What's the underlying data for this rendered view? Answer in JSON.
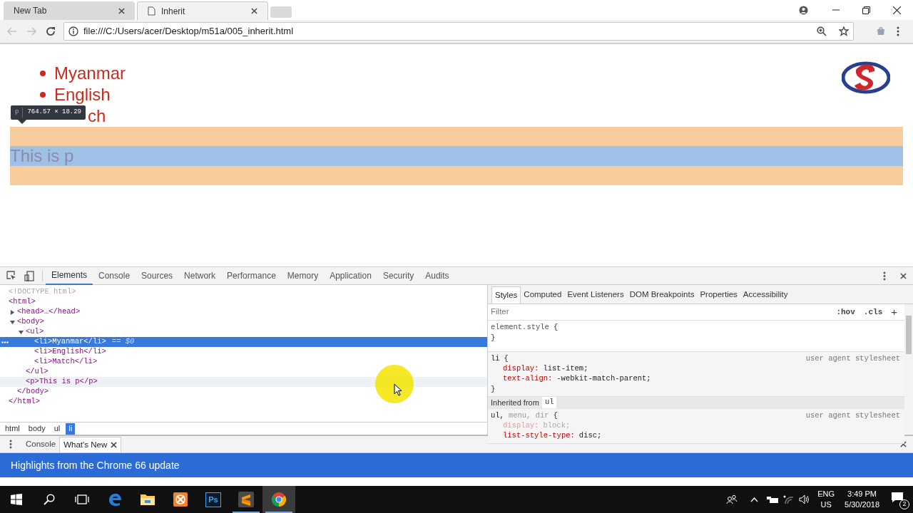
{
  "browser": {
    "tabs": [
      {
        "title": "New Tab",
        "selected": false
      },
      {
        "title": "Inherit",
        "selected": true
      }
    ],
    "url": "file:///C:/Users/acer/Desktop/m51a/005_inherit.html",
    "back_disabled": true,
    "forward_disabled": true
  },
  "page": {
    "list_items": [
      {
        "kind": "full",
        "text": "Myanmar"
      },
      {
        "kind": "full",
        "text": "English"
      },
      {
        "kind": "covered",
        "text": "ch"
      }
    ],
    "paragraph": "This is p",
    "inspect_tooltip": {
      "tag": "p",
      "size": "764.57 × 18.29"
    }
  },
  "devtools": {
    "tabs": [
      {
        "label": "Elements",
        "selected": true
      },
      {
        "label": "Console",
        "selected": false
      },
      {
        "label": "Sources",
        "selected": false
      },
      {
        "label": "Network",
        "selected": false
      },
      {
        "label": "Performance",
        "selected": false
      },
      {
        "label": "Memory",
        "selected": false
      },
      {
        "label": "Application",
        "selected": false
      },
      {
        "label": "Security",
        "selected": false
      },
      {
        "label": "Audits",
        "selected": false
      }
    ],
    "dom_tree": [
      {
        "kind": "doctype",
        "text": "<!DOCTYPE html>",
        "selected": false,
        "hovered": false
      },
      {
        "kind": "element",
        "text": "<html>",
        "selected": false,
        "hovered": false,
        "closing": "</html>",
        "children": [
          {
            "kind": "element",
            "text": "<head>…</head>",
            "expanded": false,
            "selected": false,
            "hovered": false
          },
          {
            "kind": "element",
            "text": "<body>",
            "expanded": true,
            "selected": false,
            "hovered": false,
            "closing": "</body>",
            "children": [
              {
                "kind": "element",
                "text": "<ul>",
                "expanded": true,
                "selected": false,
                "hovered": false,
                "closing": "</ul>",
                "children": [
                  {
                    "kind": "element",
                    "text": "<li>Myanmar</li>",
                    "suffix": "== $0",
                    "selected": true,
                    "hovered": false
                  },
                  {
                    "kind": "element",
                    "text": "<li>English</li>",
                    "selected": false,
                    "hovered": false
                  },
                  {
                    "kind": "element",
                    "text": "<li>Match</li>",
                    "selected": false,
                    "hovered": false
                  }
                ]
              },
              {
                "kind": "element",
                "text": "<p>This is p</p>",
                "selected": false,
                "hovered": true
              }
            ]
          }
        ]
      }
    ],
    "breadcrumbs": [
      {
        "label": "html",
        "selected": false
      },
      {
        "label": "body",
        "selected": false
      },
      {
        "label": "ul",
        "selected": false
      },
      {
        "label": "li",
        "selected": true
      }
    ],
    "sidebar_tabs": [
      {
        "label": "Styles",
        "selected": true
      },
      {
        "label": "Computed",
        "selected": false
      },
      {
        "label": "Event Listeners",
        "selected": false
      },
      {
        "label": "DOM Breakpoints",
        "selected": false
      },
      {
        "label": "Properties",
        "selected": false
      },
      {
        "label": "Accessibility",
        "selected": false
      }
    ],
    "filter_placeholder": "Filter",
    "filter_buttons": [
      ":hov",
      ".cls",
      "+"
    ],
    "style_rules": [
      {
        "kind": "inline",
        "selectors": [
          {
            "text": "element.style",
            "matched": true
          }
        ],
        "open_brace": "{",
        "close_brace": "}"
      },
      {
        "kind": "rule",
        "selectors": [
          {
            "text": "li",
            "matched": true
          }
        ],
        "open_brace": "{",
        "source": "user agent stylesheet",
        "close_brace": "}",
        "declarations": [
          {
            "prop": "display:",
            "value": "list-item;",
            "overridden": false
          },
          {
            "prop": "text-align:",
            "value": "-webkit-match-parent;",
            "overridden": false
          }
        ]
      },
      {
        "kind": "inherited",
        "label": "Inherited from",
        "tag": "ul"
      },
      {
        "kind": "rule",
        "selectors": [
          {
            "text": "ul,",
            "matched": true
          },
          {
            "text": "menu, dir",
            "matched": false
          }
        ],
        "open_brace": "{",
        "source": "user agent stylesheet",
        "declarations": [
          {
            "prop": "display:",
            "value": "block;",
            "overridden": true
          },
          {
            "prop": "list-style-type:",
            "value": "disc;",
            "overridden": false
          }
        ]
      }
    ]
  },
  "drawer": {
    "tabs": [
      {
        "label": "Console",
        "selected": false,
        "closable": false
      },
      {
        "label": "What's New",
        "selected": true,
        "closable": true
      }
    ],
    "banner": "Highlights from the Chrome 66 update"
  },
  "taskbar": {
    "apps": [
      {
        "kind": "edge",
        "running": false,
        "active": false
      },
      {
        "kind": "explorer",
        "running": false,
        "active": false
      },
      {
        "kind": "xampp",
        "running": false,
        "active": false
      },
      {
        "kind": "photoshop",
        "label": "Ps",
        "running": false,
        "active": false
      },
      {
        "kind": "sublime",
        "running": true,
        "active": false
      },
      {
        "kind": "chrome",
        "running": true,
        "active": true
      }
    ],
    "language": "ENG",
    "region": "US",
    "time": "3:49 PM",
    "date": "5/30/2018",
    "notifications": "2"
  }
}
